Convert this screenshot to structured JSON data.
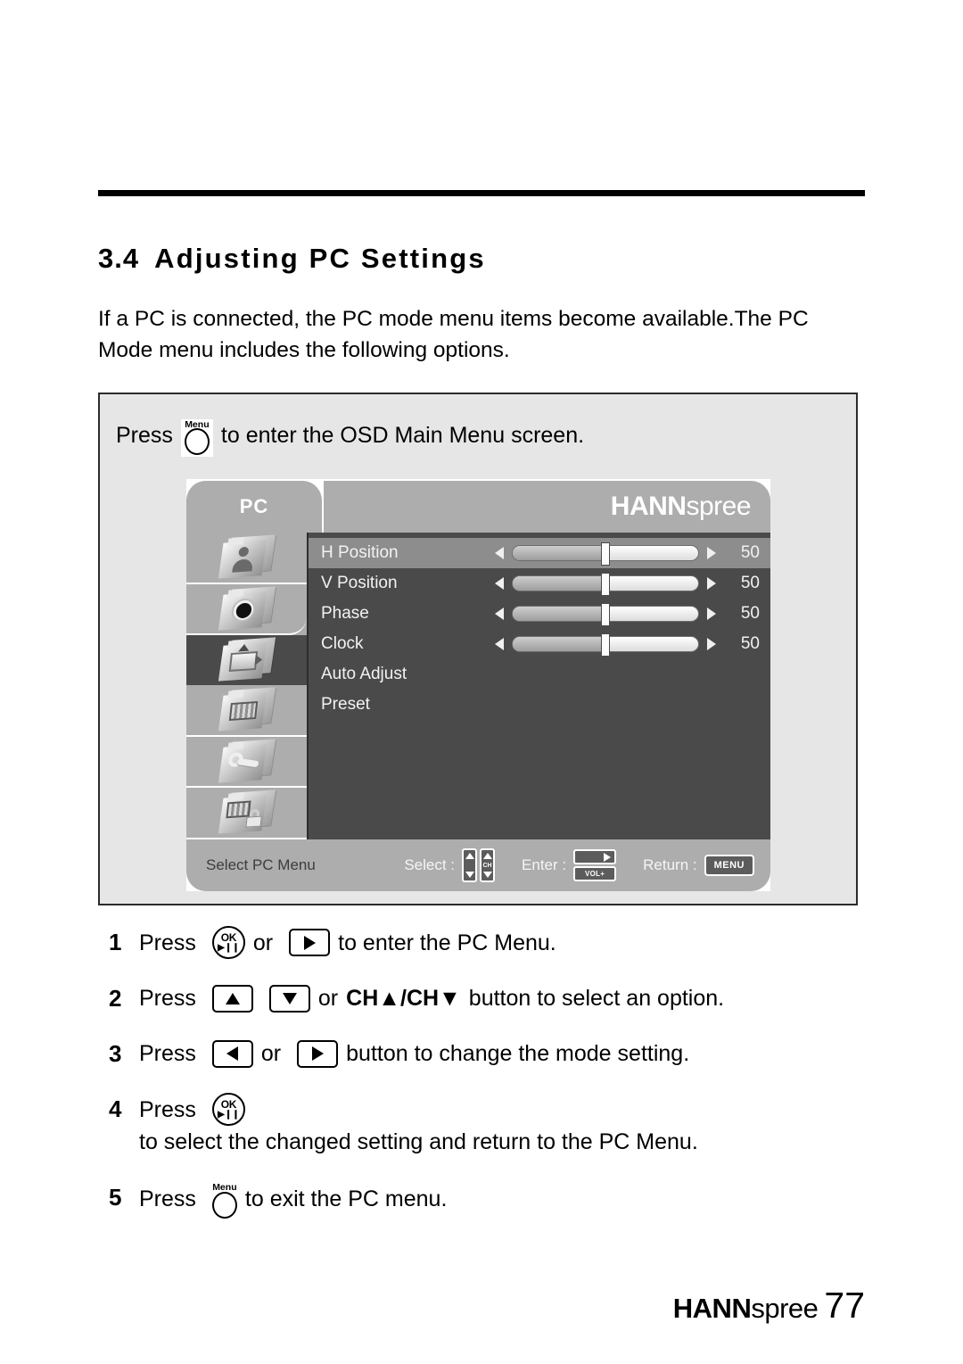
{
  "page": {
    "section_number": "3.4",
    "section_title": "Adjusting PC Settings",
    "intro": "If a PC is connected, the PC mode menu items become available.The PC Mode menu includes the following options.",
    "footer_brand_bold": "HANN",
    "footer_brand_light": "spree",
    "page_number": "77"
  },
  "panel": {
    "press_prefix": "Press",
    "menu_button_label": "Menu",
    "press_suffix": "to enter the OSD Main Menu screen."
  },
  "osd": {
    "tab_label": "PC",
    "brand_bold": "HANN",
    "brand_light": "spree",
    "sidebar_icons": [
      "picture-icon",
      "lens-icon",
      "pc-screen-icon",
      "color-bars-icon",
      "wrench-setup-icon",
      "lock-screen-icon"
    ],
    "active_sidebar_index": 2,
    "rows": [
      {
        "label": "H Position",
        "value": "50",
        "percent": 50,
        "has_slider": true,
        "highlight": true
      },
      {
        "label": "V Position",
        "value": "50",
        "percent": 50,
        "has_slider": true,
        "highlight": false
      },
      {
        "label": "Phase",
        "value": "50",
        "percent": 50,
        "has_slider": true,
        "highlight": false
      },
      {
        "label": "Clock",
        "value": "50",
        "percent": 50,
        "has_slider": true,
        "highlight": false
      },
      {
        "label": "Auto Adjust",
        "value": "",
        "percent": 0,
        "has_slider": false,
        "highlight": false
      },
      {
        "label": "Preset",
        "value": "",
        "percent": 0,
        "has_slider": false,
        "highlight": false
      }
    ],
    "footer": {
      "status": "Select PC Menu",
      "select_label": "Select :",
      "select_icon_text": "CH",
      "enter_label": "Enter :",
      "enter_icon_text": "VOL+",
      "return_label": "Return :",
      "return_key_text": "MENU"
    }
  },
  "steps": [
    {
      "n": "1",
      "w1": "Press",
      "w2": "or",
      "w3": "to enter the PC Menu."
    },
    {
      "n": "2",
      "w1": "Press",
      "w2": "or",
      "w3": "CH▲/CH▼",
      "w4": "button to select an option."
    },
    {
      "n": "3",
      "w1": "Press",
      "w2": "or",
      "w3": "button to change the mode setting."
    },
    {
      "n": "4",
      "w1": "Press",
      "w2": "to select the changed setting and return to the PC Menu."
    },
    {
      "n": "5",
      "w1": "Press",
      "w2": "to exit the PC menu.",
      "menu_label": "Menu"
    }
  ],
  "colors": {
    "osd_panel_bg": "#4a4a4a",
    "osd_chrome": "#adadad",
    "osd_highlight": "#8d8d8d",
    "panel_bg": "#e6e6e6",
    "rule": "#000000"
  }
}
